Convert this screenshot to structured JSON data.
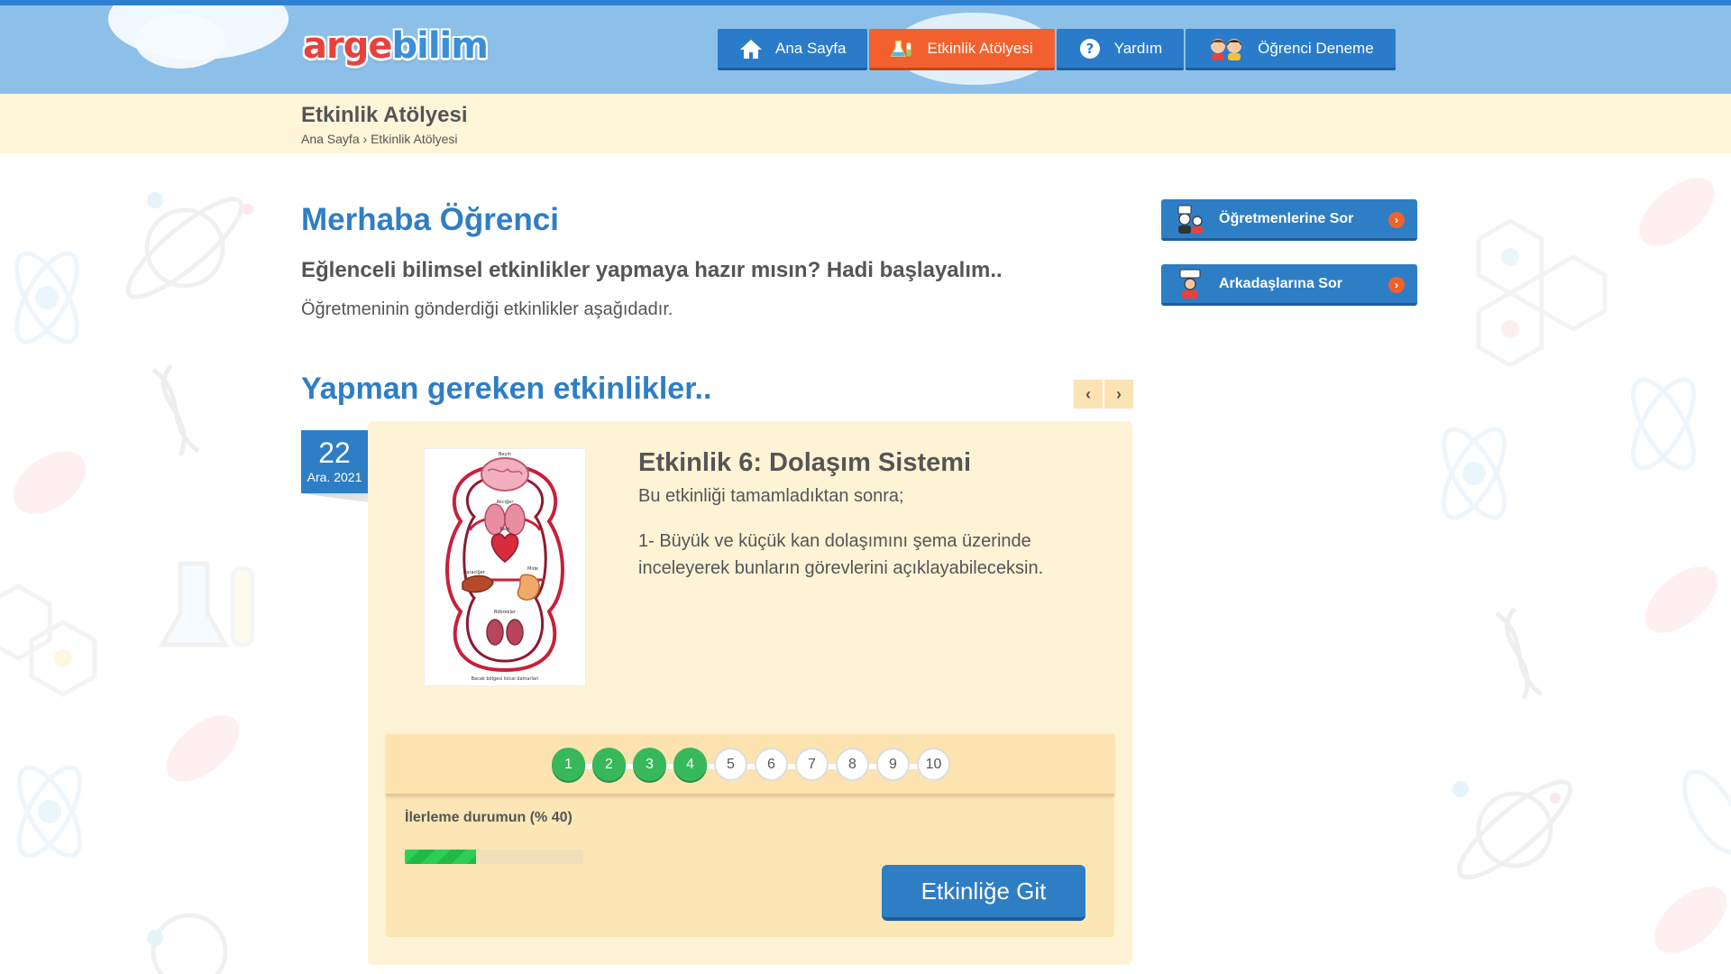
{
  "header": {
    "logo": {
      "part1": "arge",
      "part2": "bilim"
    },
    "nav": [
      {
        "label": "Ana Sayfa",
        "icon": "home-icon"
      },
      {
        "label": "Etkinlik Atölyesi",
        "icon": "lab-icon",
        "active": true
      },
      {
        "label": "Yardım",
        "icon": "help-icon"
      },
      {
        "label": "Öğrenci Deneme",
        "icon": "students-icon"
      }
    ]
  },
  "titlebar": {
    "title": "Etkinlik Atölyesi",
    "breadcrumb": [
      "Ana Sayfa",
      "Etkinlik Atölyesi"
    ],
    "separator": "›"
  },
  "main": {
    "greeting": "Merhaba Öğrenci",
    "subheading": "Eğlenceli bilimsel etkinlikler yapmaya hazır mısın? Hadi başlayalım..",
    "lead": "Öğretmeninin gönderdiği etkinlikler aşağıdadır.",
    "section_title": "Yapman gereken etkinlikler..",
    "carousel": {
      "prev": "‹",
      "next": "›"
    }
  },
  "activity": {
    "date": {
      "day": "22",
      "month": "Ara. 2021"
    },
    "title": "Etkinlik 6: Dolaşım Sistemi",
    "intro": "Bu etkinliği tamamladıktan sonra;",
    "objective": "1- Büyük ve küçük kan dolaşımını şema üzerinde inceleyerek bunların görevlerini açıklayabileceksin.",
    "diagram_labels": {
      "top": "Beyin",
      "lungs": "Akciğer",
      "heart": "Kalp",
      "liver": "Karaciğer",
      "stomach": "Mide",
      "kidneys": "Böbrekler",
      "bottom": "Bacak bölgesi kılcal damarları"
    },
    "steps": [
      {
        "n": "1",
        "done": true
      },
      {
        "n": "2",
        "done": true
      },
      {
        "n": "3",
        "done": true
      },
      {
        "n": "4",
        "done": true
      },
      {
        "n": "5",
        "done": false
      },
      {
        "n": "6",
        "done": false
      },
      {
        "n": "7",
        "done": false
      },
      {
        "n": "8",
        "done": false
      },
      {
        "n": "9",
        "done": false
      },
      {
        "n": "10",
        "done": false
      }
    ],
    "progress_label": "İlerleme durumun (% 40)",
    "progress": 0.4,
    "button": "Etkinliğe Git"
  },
  "sidebar": {
    "buttons": [
      {
        "label": "Öğretmenlerine Sor",
        "icon": "teachers-icon"
      },
      {
        "label": "Arkadaşlarına Sor",
        "icon": "friends-icon"
      }
    ]
  },
  "colors": {
    "primary": "#2e7ec5",
    "accent": "#f2612d",
    "success": "#37b85a",
    "header_bg": "#8dc0e8",
    "cream": "#fff3d6"
  }
}
